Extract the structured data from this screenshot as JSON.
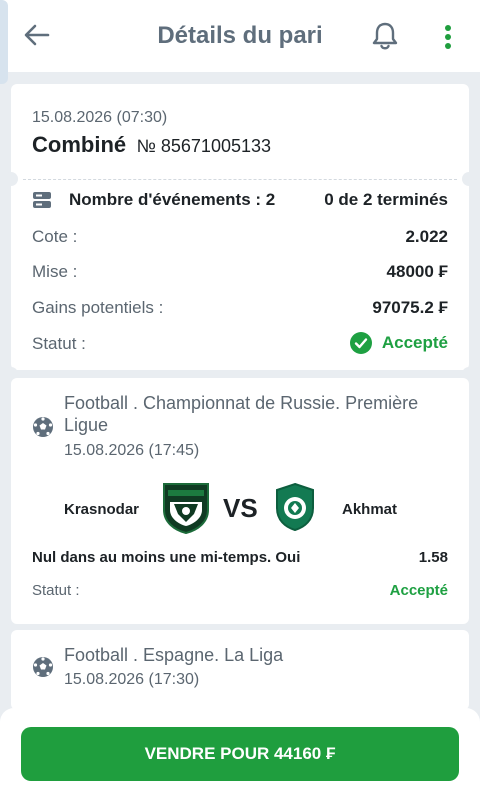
{
  "header": {
    "title": "Détails du pari",
    "back_icon": "back-arrow-icon",
    "bell_icon": "bell-icon",
    "menu_icon": "more-vertical-icon"
  },
  "bet": {
    "datetime": "15.08.2026 (07:30)",
    "type": "Combiné",
    "number_label": "№ 85671005133",
    "events_label": "Nombre d'événements : 2",
    "events_status": "0 de 2 terminés",
    "rows": [
      {
        "label": "Cote :",
        "value": "2.022"
      },
      {
        "label": "Mise :",
        "value": "48000 ₣"
      },
      {
        "label": "Gains potentiels :",
        "value": "97075.2 ₣"
      }
    ],
    "status_label": "Statut :",
    "status_value": "Accepté"
  },
  "events": [
    {
      "league": "Football . Championnat de Russie. Première Ligue",
      "datetime": "15.08.2026 (17:45)",
      "home": "Krasnodar",
      "vs": "VS",
      "away": "Akhmat",
      "market": "Nul dans au moins une mi-temps. Oui",
      "odds": "1.58",
      "status_label": "Statut :",
      "status_value": "Accepté"
    },
    {
      "league": "Football . Espagne. La Liga",
      "datetime": "15.08.2026 (17:30)"
    }
  ],
  "footer": {
    "sell_label": "VENDRE POUR 44160 ₣"
  },
  "colors": {
    "accent": "#1f9e3e",
    "status_green": "#1ea042",
    "muted_text": "#5b6670"
  }
}
